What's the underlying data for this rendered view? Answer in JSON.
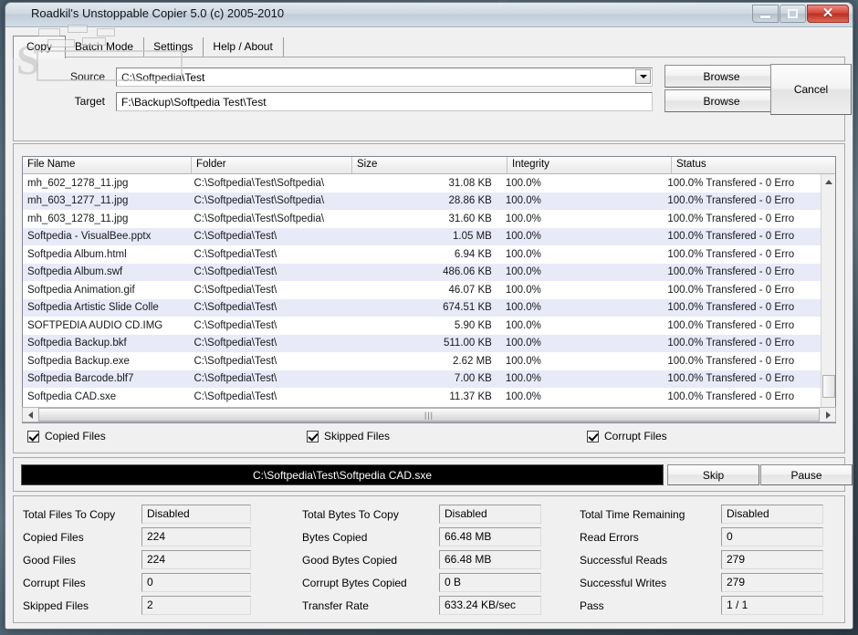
{
  "window": {
    "title": "Roadkil's Unstoppable Copier 5.0 (c) 2005-2010",
    "minimize_label": "Minimize",
    "maximize_label": "Maximize",
    "close_label": "Close",
    "close_glyph": "✕",
    "desktop_watermark": "SOFTPEDIA"
  },
  "tabs": [
    {
      "label": "Copy",
      "active": true
    },
    {
      "label": "Batch Mode",
      "active": false
    },
    {
      "label": "Settings",
      "active": false
    },
    {
      "label": "Help / About",
      "active": false
    }
  ],
  "paths": {
    "source_label": "Source",
    "source_value": "C:\\Softpedia\\Test",
    "target_label": "Target",
    "target_value": "F:\\Backup\\Softpedia Test\\Test",
    "browse_source_label": "Browse",
    "browse_target_label": "Browse",
    "cancel_label": "Cancel"
  },
  "filelist": {
    "columns": [
      "File Name",
      "Folder",
      "Size",
      "Integrity",
      "Status"
    ],
    "rows": [
      {
        "name": "mh_602_1278_11.jpg",
        "folder": "C:\\Softpedia\\Test\\Softpedia\\",
        "size": "31.08 KB",
        "integrity": "100.0%",
        "status": "100.0% Transfered - 0 Erro"
      },
      {
        "name": "mh_603_1277_11.jpg",
        "folder": "C:\\Softpedia\\Test\\Softpedia\\",
        "size": "28.86 KB",
        "integrity": "100.0%",
        "status": "100.0% Transfered - 0 Erro"
      },
      {
        "name": "mh_603_1278_11.jpg",
        "folder": "C:\\Softpedia\\Test\\Softpedia\\",
        "size": "31.60 KB",
        "integrity": "100.0%",
        "status": "100.0% Transfered - 0 Erro"
      },
      {
        "name": "Softpedia - VisualBee.pptx",
        "folder": "C:\\Softpedia\\Test\\",
        "size": "1.05 MB",
        "integrity": "100.0%",
        "status": "100.0% Transfered - 0 Erro"
      },
      {
        "name": "Softpedia Album.html",
        "folder": "C:\\Softpedia\\Test\\",
        "size": "6.94 KB",
        "integrity": "100.0%",
        "status": "100.0% Transfered - 0 Erro"
      },
      {
        "name": "Softpedia Album.swf",
        "folder": "C:\\Softpedia\\Test\\",
        "size": "486.06 KB",
        "integrity": "100.0%",
        "status": "100.0% Transfered - 0 Erro"
      },
      {
        "name": "Softpedia Animation.gif",
        "folder": "C:\\Softpedia\\Test\\",
        "size": "46.07 KB",
        "integrity": "100.0%",
        "status": "100.0% Transfered - 0 Erro"
      },
      {
        "name": "Softpedia Artistic Slide Colle",
        "folder": "C:\\Softpedia\\Test\\",
        "size": "674.51 KB",
        "integrity": "100.0%",
        "status": "100.0% Transfered - 0 Erro"
      },
      {
        "name": "SOFTPEDIA AUDIO CD.IMG",
        "folder": "C:\\Softpedia\\Test\\",
        "size": "5.90 KB",
        "integrity": "100.0%",
        "status": "100.0% Transfered - 0 Erro"
      },
      {
        "name": "Softpedia Backup.bkf",
        "folder": "C:\\Softpedia\\Test\\",
        "size": "511.00 KB",
        "integrity": "100.0%",
        "status": "100.0% Transfered - 0 Erro"
      },
      {
        "name": "Softpedia Backup.exe",
        "folder": "C:\\Softpedia\\Test\\",
        "size": "2.62 MB",
        "integrity": "100.0%",
        "status": "100.0% Transfered - 0 Erro"
      },
      {
        "name": "Softpedia Barcode.blf7",
        "folder": "C:\\Softpedia\\Test\\",
        "size": "7.00 KB",
        "integrity": "100.0%",
        "status": "100.0% Transfered - 0 Erro"
      },
      {
        "name": "Softpedia CAD.sxe",
        "folder": "C:\\Softpedia\\Test\\",
        "size": "11.37 KB",
        "integrity": "100.0%",
        "status": "100.0% Transfered - 0 Erro"
      }
    ]
  },
  "filters": [
    {
      "label": "Copied Files",
      "checked": true
    },
    {
      "label": "Skipped Files",
      "checked": true
    },
    {
      "label": "Corrupt Files",
      "checked": true
    }
  ],
  "progress": {
    "current_file": "C:\\Softpedia\\Test\\Softpedia CAD.sxe",
    "skip_label": "Skip",
    "pause_label": "Pause"
  },
  "stats": {
    "col1": [
      {
        "label": "Total Files To Copy",
        "value": "Disabled"
      },
      {
        "label": "Copied Files",
        "value": "224"
      },
      {
        "label": "Good Files",
        "value": "224"
      },
      {
        "label": "Corrupt Files",
        "value": "0"
      },
      {
        "label": "Skipped Files",
        "value": "2"
      }
    ],
    "col2": [
      {
        "label": "Total Bytes To Copy",
        "value": "Disabled"
      },
      {
        "label": "Bytes Copied",
        "value": "66.48 MB"
      },
      {
        "label": "Good Bytes Copied",
        "value": "66.48 MB"
      },
      {
        "label": "Corrupt Bytes Copied",
        "value": "0 B"
      },
      {
        "label": "Transfer Rate",
        "value": "633.24 KB/sec"
      }
    ],
    "col3": [
      {
        "label": "Total Time Remaining",
        "value": "Disabled"
      },
      {
        "label": "Read Errors",
        "value": "0"
      },
      {
        "label": "Successful Reads",
        "value": "279"
      },
      {
        "label": "Successful Writes",
        "value": "279"
      },
      {
        "label": "Pass",
        "value": "1 / 1"
      }
    ]
  },
  "colors": {
    "alt_row": "#e9eaf8",
    "progress_bg": "#000000",
    "close_button": "#c8392b"
  }
}
